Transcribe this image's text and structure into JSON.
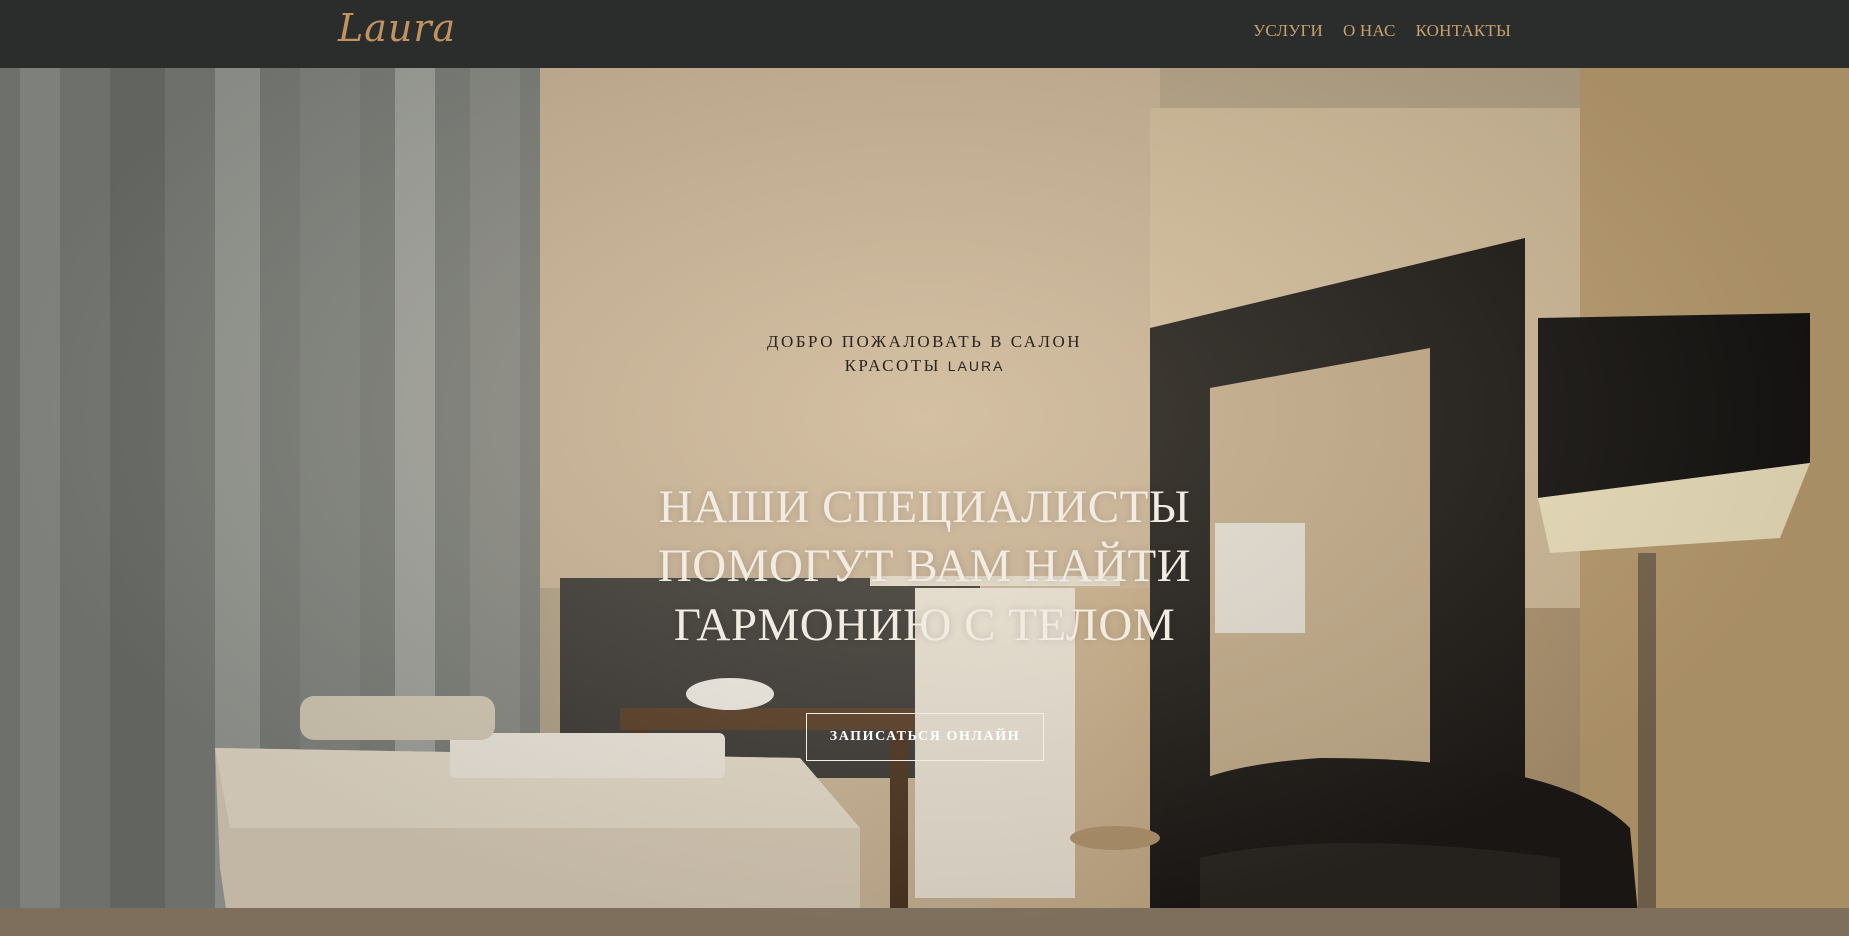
{
  "header": {
    "logo_text": "Laura",
    "nav": [
      {
        "label": "УСЛУГИ"
      },
      {
        "label": "О НАС"
      },
      {
        "label": "КОНТАКТЫ"
      }
    ]
  },
  "hero": {
    "welcome_line1": "ДОБРО ПОЖАЛОВАТЬ В САЛОН",
    "welcome_line2_prefix": "КРАСОТЫ ",
    "welcome_brand": "LAURA",
    "headline_lines": [
      "НАШИ СПЕЦИАЛИСТЫ",
      "ПОМОГУТ ВАМ НАЙТИ",
      "ГАРМОНИЮ С ТЕЛОМ"
    ],
    "cta_label": "ЗАПИСАТЬСЯ ОНЛАЙН",
    "background_image": "salon-massage-room-photo"
  },
  "colors": {
    "header_bg": "#2b2d2d",
    "accent_gold": "#c9a06d",
    "headline": "#f1ebe2"
  }
}
